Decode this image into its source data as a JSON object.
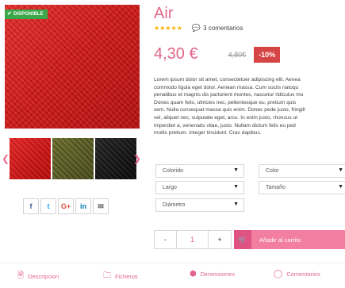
{
  "product": {
    "badge": "DISPONIBLE",
    "title": "Air",
    "stars": "★★★★★",
    "comments": "3 comentarios",
    "price": "4,30 €",
    "old_price": "4,80€",
    "discount": "-10%",
    "description": [
      "Lorem ipsum dolor sit amet, consectetuer adipiscing elit. Aenea",
      "commodo ligula eget dolor. Aenean massa. Cum sociis natoqu",
      "penatibus et magnis dis parturient montes, nascetur ridiculus mu",
      "Donec quam felis, ultricies nec, pellentesque eu, pretium quis",
      "sem. Nulla consequat massa quis enim. Donec pede justo, fringill",
      "vel, aliquet nec, vulputate eget, arcu. In enim justo, rhoncus ut",
      "imperdiet a, venenatis vitae, justo. Nullam dictum felis eu ped",
      "mollis pretium. Integer tincidunt. Cras dapibus."
    ]
  },
  "gallery": {
    "prev_icon": "chevron-left-icon",
    "next_icon": "chevron-right-icon"
  },
  "share": {
    "facebook": "f",
    "twitter": "t",
    "googleplus": "G+",
    "linkedin": "in",
    "email": "✉"
  },
  "options": {
    "colorido": "Colorido",
    "color": "Color",
    "largo": "Largo",
    "tamano": "Tamaño",
    "diametro": "Diámetro"
  },
  "quantity": {
    "minus": "-",
    "value": "1",
    "plus": "+"
  },
  "cart": {
    "label": "Añadir al carrito"
  },
  "tabs": [
    {
      "label": "Descripcion",
      "icon": "document-icon"
    },
    {
      "label": "Ficheros",
      "icon": "folder-icon"
    },
    {
      "label": "Dimensiones",
      "icon": "cube-icon"
    },
    {
      "label": "Comentarios",
      "icon": "chat-bubble-icon"
    }
  ],
  "colors": {
    "accent": "#e2668a",
    "badge": "#3aa84a",
    "discount": "#d64545",
    "cart": "#f27ea2"
  }
}
